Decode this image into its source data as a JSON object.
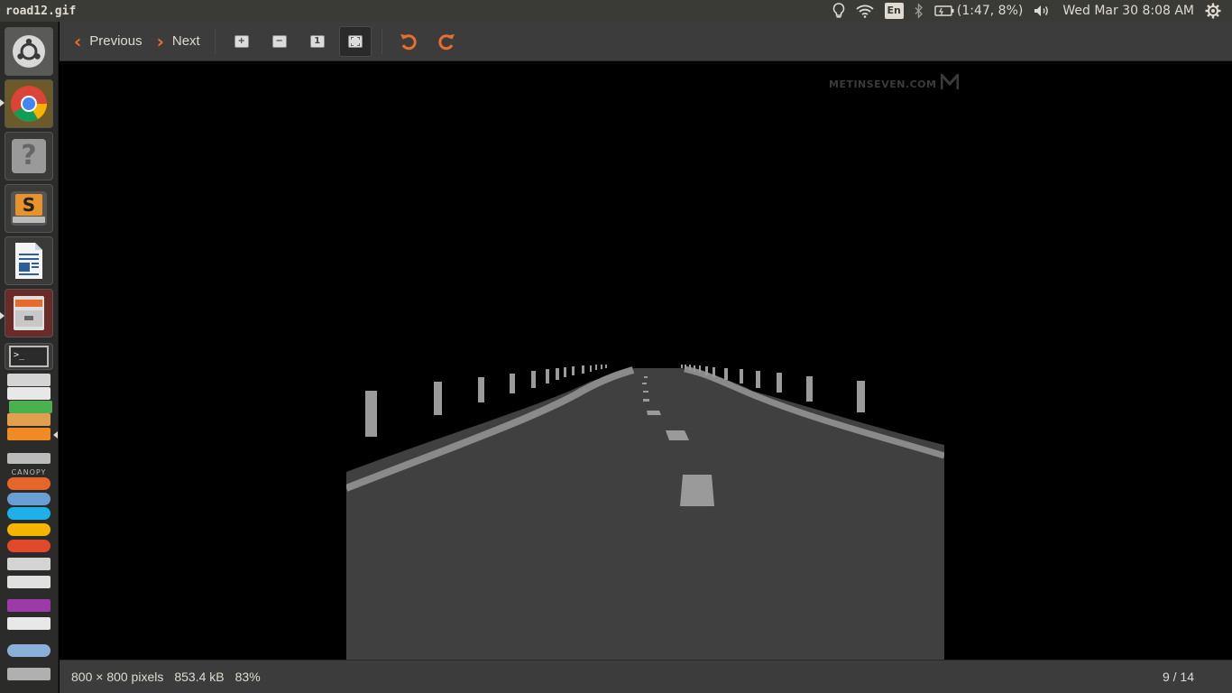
{
  "window": {
    "title": "road12.gif"
  },
  "panel": {
    "keyboard_layout": "En",
    "battery": "(1:47, 8%)",
    "clock": "Wed Mar 30  8:08 AM"
  },
  "toolbar": {
    "previous_label": "Previous",
    "next_label": "Next",
    "zoom_in_icon": "zoom-in-icon",
    "zoom_out_icon": "zoom-out-icon",
    "normal_size_icon": "normal-size-icon",
    "best_fit_icon": "best-fit-icon",
    "rotate_left_icon": "rotate-left-icon",
    "rotate_right_icon": "rotate-right-icon",
    "accent_color": "#e96e2c"
  },
  "image": {
    "watermark": "METINSEVEN.COM"
  },
  "status": {
    "dimensions": "800 × 800 pixels",
    "file_size": "853.4 kB",
    "zoom": "83%",
    "position": "9 / 14"
  },
  "launcher": {
    "items": [
      "ubuntu-dash-icon",
      "chrome-icon",
      "help-icon",
      "sublime-text-icon",
      "libreoffice-writer-icon",
      "file-cabinet-icon",
      "terminal-icon"
    ],
    "stacked_items": [
      "text-editor-icon",
      "document-viewer-icon",
      "office-impress-icon",
      "vlc-icon",
      "canopy-icon",
      "firefox-icon",
      "network-icon",
      "skype-icon",
      "chrome-beta-icon",
      "remmina-icon",
      "scanner-icon",
      "screenshot-icon",
      "media-icon",
      "phone-icon",
      "disk-icon",
      "trash-icon"
    ],
    "stacked_label": "CANOPY"
  }
}
